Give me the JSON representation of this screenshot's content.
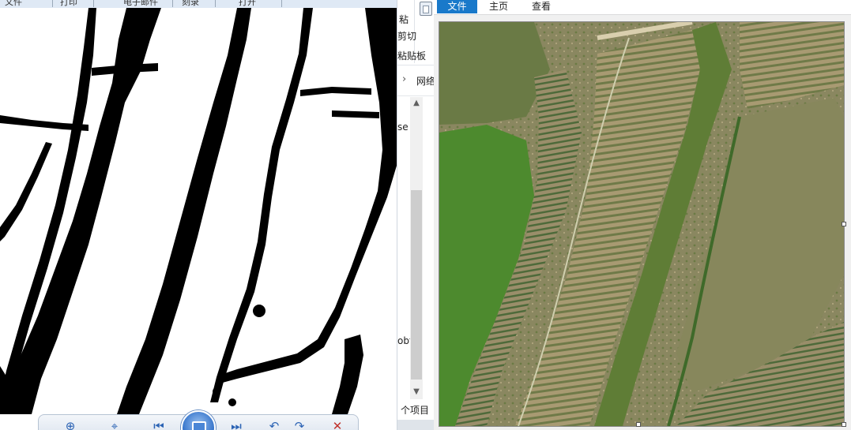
{
  "viewer": {
    "topbar_items": [
      "文件",
      "打印",
      "电子邮件",
      "刻录",
      "打开"
    ],
    "toolbar_icons": [
      "zoom-icon",
      "fit-icon",
      "previous-icon",
      "slideshow-icon",
      "next-icon",
      "rotate-left-icon",
      "rotate-right-icon",
      "delete-icon"
    ],
    "mask_colors": {
      "foreground": "#000000",
      "background": "#ffffff"
    }
  },
  "explorer": {
    "ribbon": {
      "row1": "粘",
      "cut_label": "剪切",
      "row3": "粘贴板"
    },
    "nav_item": "网络",
    "partial_name_1": "se",
    "partial_name_2": "obt",
    "status": "个项目"
  },
  "photo_app": {
    "tabs": [
      "文件",
      "主页",
      "查看"
    ],
    "active_tab": "文件",
    "accent_color": "#1979ca"
  }
}
